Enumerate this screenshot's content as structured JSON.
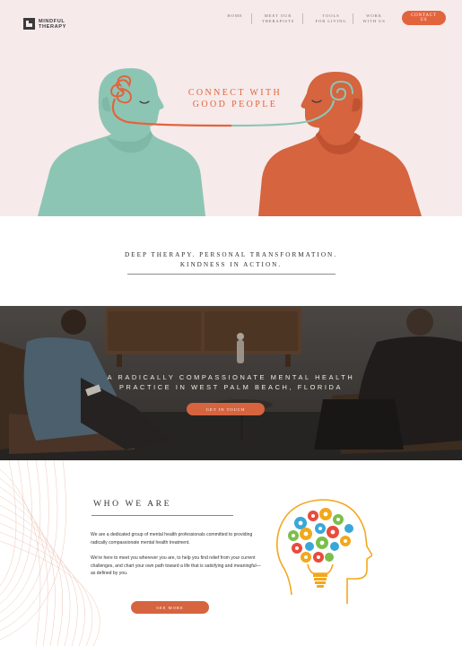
{
  "nav": {
    "logo_line1": "MINDFUL",
    "logo_line2": "THERAPY",
    "items": [
      {
        "line1": "HOME",
        "line2": ""
      },
      {
        "line1": "MEET OUR",
        "line2": "THERAPISTS"
      },
      {
        "line1": "TOOLS",
        "line2": "FOR LIVING"
      },
      {
        "line1": "WORK",
        "line2": "WITH US"
      }
    ],
    "contact_label": "CONTACT US"
  },
  "hero": {
    "title_line1": "CONNECT WITH",
    "title_line2": "GOOD PEOPLE"
  },
  "tagline": {
    "line1": "DEEP THERAPY. PERSONAL TRANSFORMATION.",
    "line2": "KINDNESS IN ACTION."
  },
  "photo_band": {
    "title_line1": "A RADICALLY COMPASSIONATE MENTAL HEALTH",
    "title_line2": "PRACTICE IN WEST PALM BEACH, FLORIDA",
    "button_label": "GET IN TOUCH"
  },
  "who": {
    "title": "WHO WE ARE",
    "paragraph1": "We are a dedicated group of mental health professionals committed to providing radically compassionate mental health treatment.",
    "paragraph2": "We're here to meet you wherever you are, to help you find relief from your current challenges, and chart your own path toward a life that is satisfying and meaningful—as defined by you.",
    "button_label": "SEE MORE"
  },
  "colors": {
    "accent": "#e2643d",
    "hero_bg": "#f6eaea",
    "teal": "#8dc5b4",
    "dark": "#333333"
  },
  "icons": [
    "logo-mark-icon",
    "brain-gears-icon",
    "lightbulb-icon"
  ]
}
